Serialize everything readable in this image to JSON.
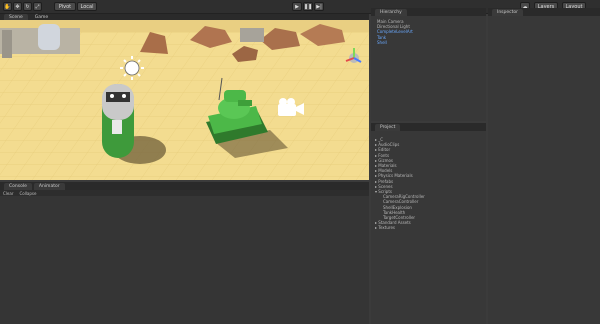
{
  "toolbar": {
    "tools": [
      "hand-tool",
      "move-tool",
      "rotate-tool",
      "scale-tool"
    ],
    "pivot_label": "Pivot",
    "local_label": "Local",
    "play_controls": [
      "play-icon",
      "pause-icon",
      "step-icon"
    ],
    "right_buttons": [
      "Layers",
      "Layout"
    ]
  },
  "scene_tabs": [
    "Scene",
    "Game"
  ],
  "hierarchy": {
    "tab_label": "Hierarchy",
    "items": [
      {
        "label": "Main Camera",
        "selected": false
      },
      {
        "label": "Directional Light",
        "selected": false
      },
      {
        "label": "CompleteLevelArt",
        "selected": true
      },
      {
        "label": "Tank",
        "selected": true
      },
      {
        "label": "Shell",
        "selected": true
      }
    ]
  },
  "project": {
    "tab_label": "Project",
    "items": [
      "▸ _C",
      "▸ AudioClips",
      "▸ Editor",
      "▸ Fonts",
      "▸ Gizmos",
      "▸ Materials",
      "▸ Models",
      "▸ Physics Materials",
      "▸ Prefabs",
      "▸ Scenes",
      "▾ Scripts",
      "CameraRigController",
      "CameraController",
      "ShellExplosion",
      "TankHealth",
      "TargetController",
      "▸ Standard Assets",
      "▸ Textures"
    ]
  },
  "inspector": {
    "tab_label": "Inspector"
  },
  "bottom_tabs": [
    "Console",
    "Animator"
  ],
  "bottom_buttons": [
    "Clear",
    "Collapse"
  ],
  "colors": {
    "sand": "#f1d98e",
    "tank": "#4cb848",
    "panel": "#383838"
  }
}
